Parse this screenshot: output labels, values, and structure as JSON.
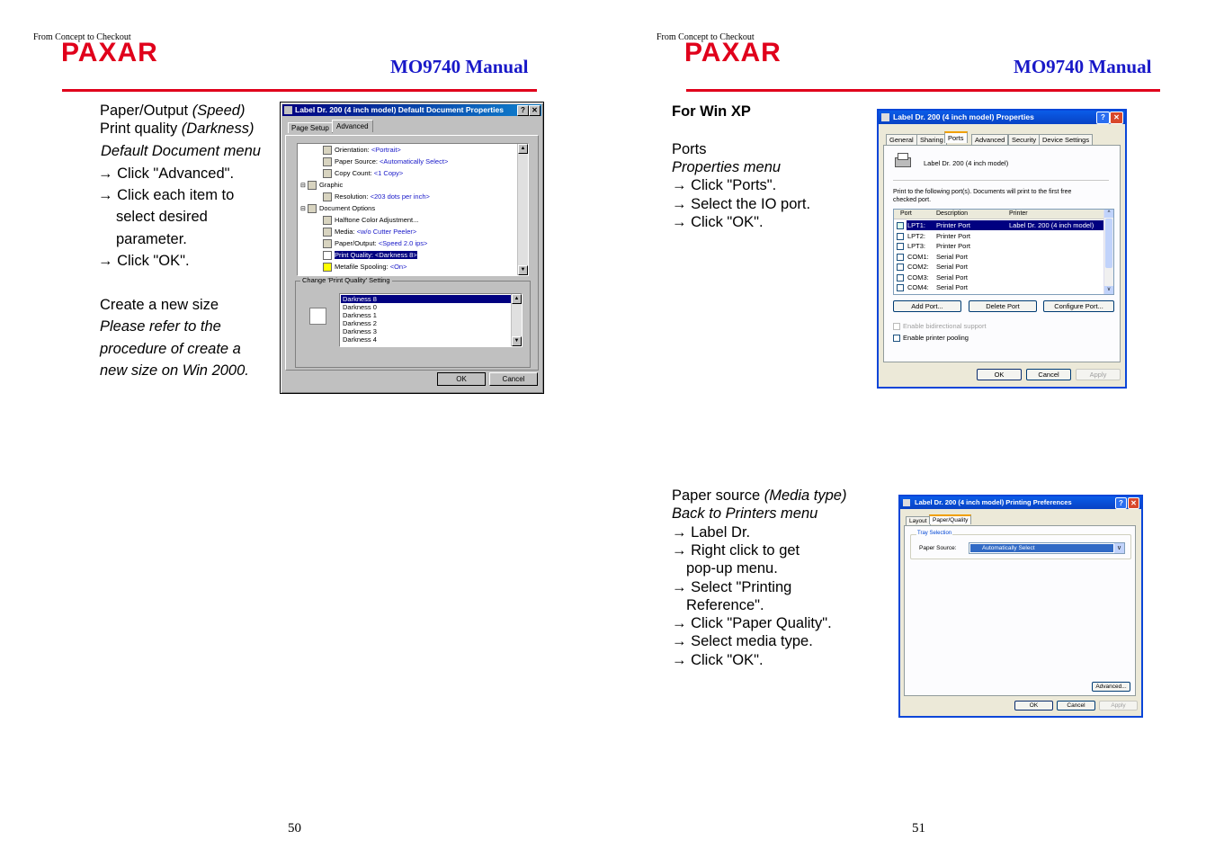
{
  "tagline": "From Concept to Checkout",
  "logo": "PAXAR",
  "manual_title": "MO9740 Manual",
  "left_page": {
    "page_number": "50",
    "text": {
      "line1_a": "Paper/Output ",
      "line1_b": "(Speed)",
      "line2_a": "Print quality ",
      "line2_b": "(Darkness)",
      "line3": "Default Document menu",
      "line4": "→ Click \"Advanced\".",
      "line5": "→ Click each item to",
      "line6": "select desired",
      "line7": "parameter.",
      "line8": "→ Click \"OK\".",
      "line9": "Create a new size",
      "line10": "Please refer to the",
      "line11": "procedure of create a",
      "line12": "new size on Win 2000."
    },
    "dialog": {
      "title": "Label Dr. 200 (4 inch model) Default Document Properties",
      "help_btn": "?",
      "close_btn": "✕",
      "tabs": [
        "Page Setup",
        "Advanced"
      ],
      "tree": [
        {
          "label": "Orientation: ",
          "value": "<Portrait>"
        },
        {
          "label": "Paper Source: ",
          "value": "<Automatically Select>"
        },
        {
          "label": "Copy Count: ",
          "value": "<1 Copy>"
        },
        {
          "label": "Graphic",
          "value": ""
        },
        {
          "label": "Resolution: ",
          "value": "<203 dots per inch>"
        },
        {
          "label": "Document Options",
          "value": ""
        },
        {
          "label": "Halftone Color Adjustment...",
          "value": ""
        },
        {
          "label": "Media: ",
          "value": "<w/o Cutter Peeler>"
        },
        {
          "label": "Paper/Output: ",
          "value": "<Speed 2.0 ips>"
        },
        {
          "label": "Print Quality: ",
          "value": "<Darkness 8>"
        },
        {
          "label": "Metafile Spooling: ",
          "value": "<On>"
        }
      ],
      "group_label": "Change 'Print Quality' Setting",
      "list": [
        "Darkness 8",
        "Darkness 0",
        "Darkness 1",
        "Darkness 2",
        "Darkness 3",
        "Darkness 4"
      ],
      "ok": "OK",
      "cancel": "Cancel"
    }
  },
  "right_page": {
    "page_number": "51",
    "section1": {
      "heading": "For Win XP",
      "line1": "Ports",
      "line2": "Properties menu",
      "line3": "→ Click \"Ports\".",
      "line4": "→ Select the IO port.",
      "line5": "→ Click \"OK\"."
    },
    "dialog1": {
      "title": "Label Dr. 200 (4 inch model) Properties",
      "help_btn": "?",
      "close_btn": "✕",
      "tabs": [
        "General",
        "Sharing",
        "Ports",
        "Advanced",
        "Security",
        "Device Settings"
      ],
      "printer_name": "Label Dr. 200 (4 inch model)",
      "instruction": "Print to the following port(s). Documents will print to the first free checked port.",
      "columns": [
        "Port",
        "Description",
        "Printer"
      ],
      "ports": [
        {
          "port": "LPT1:",
          "desc": "Printer Port",
          "printer": "Label Dr. 200 (4 inch model)"
        },
        {
          "port": "LPT2:",
          "desc": "Printer Port",
          "printer": ""
        },
        {
          "port": "LPT3:",
          "desc": "Printer Port",
          "printer": ""
        },
        {
          "port": "COM1:",
          "desc": "Serial Port",
          "printer": ""
        },
        {
          "port": "COM2:",
          "desc": "Serial Port",
          "printer": ""
        },
        {
          "port": "COM3:",
          "desc": "Serial Port",
          "printer": ""
        },
        {
          "port": "COM4:",
          "desc": "Serial Port",
          "printer": ""
        }
      ],
      "add_port": "Add Port...",
      "delete_port": "Delete Port",
      "configure_port": "Configure Port...",
      "bidirectional": "Enable bidirectional support",
      "pooling": "Enable printer pooling",
      "ok": "OK",
      "cancel": "Cancel",
      "apply": "Apply"
    },
    "section2": {
      "line1_a": "Paper source ",
      "line1_b": "(Media type)",
      "line2": "Back to Printers menu",
      "line3": "→ Label Dr.",
      "line4": "→ Right click to get",
      "line5": "pop-up menu.",
      "line6": "→ Select \"Printing",
      "line7": "Reference\".",
      "line8": "→ Click \"Paper Quality\".",
      "line9": "→ Select media type.",
      "line10": "→ Click \"OK\"."
    },
    "dialog2": {
      "title": "Label Dr. 200 (4 inch model) Printing Preferences",
      "help_btn": "?",
      "close_btn": "✕",
      "tabs": [
        "Layout",
        "Paper/Quality"
      ],
      "group_label": "Tray Selection",
      "paper_source_label": "Paper Source:",
      "paper_source_value": "Automatically Select",
      "advanced": "Advanced...",
      "ok": "OK",
      "cancel": "Cancel",
      "apply": "Apply"
    }
  }
}
